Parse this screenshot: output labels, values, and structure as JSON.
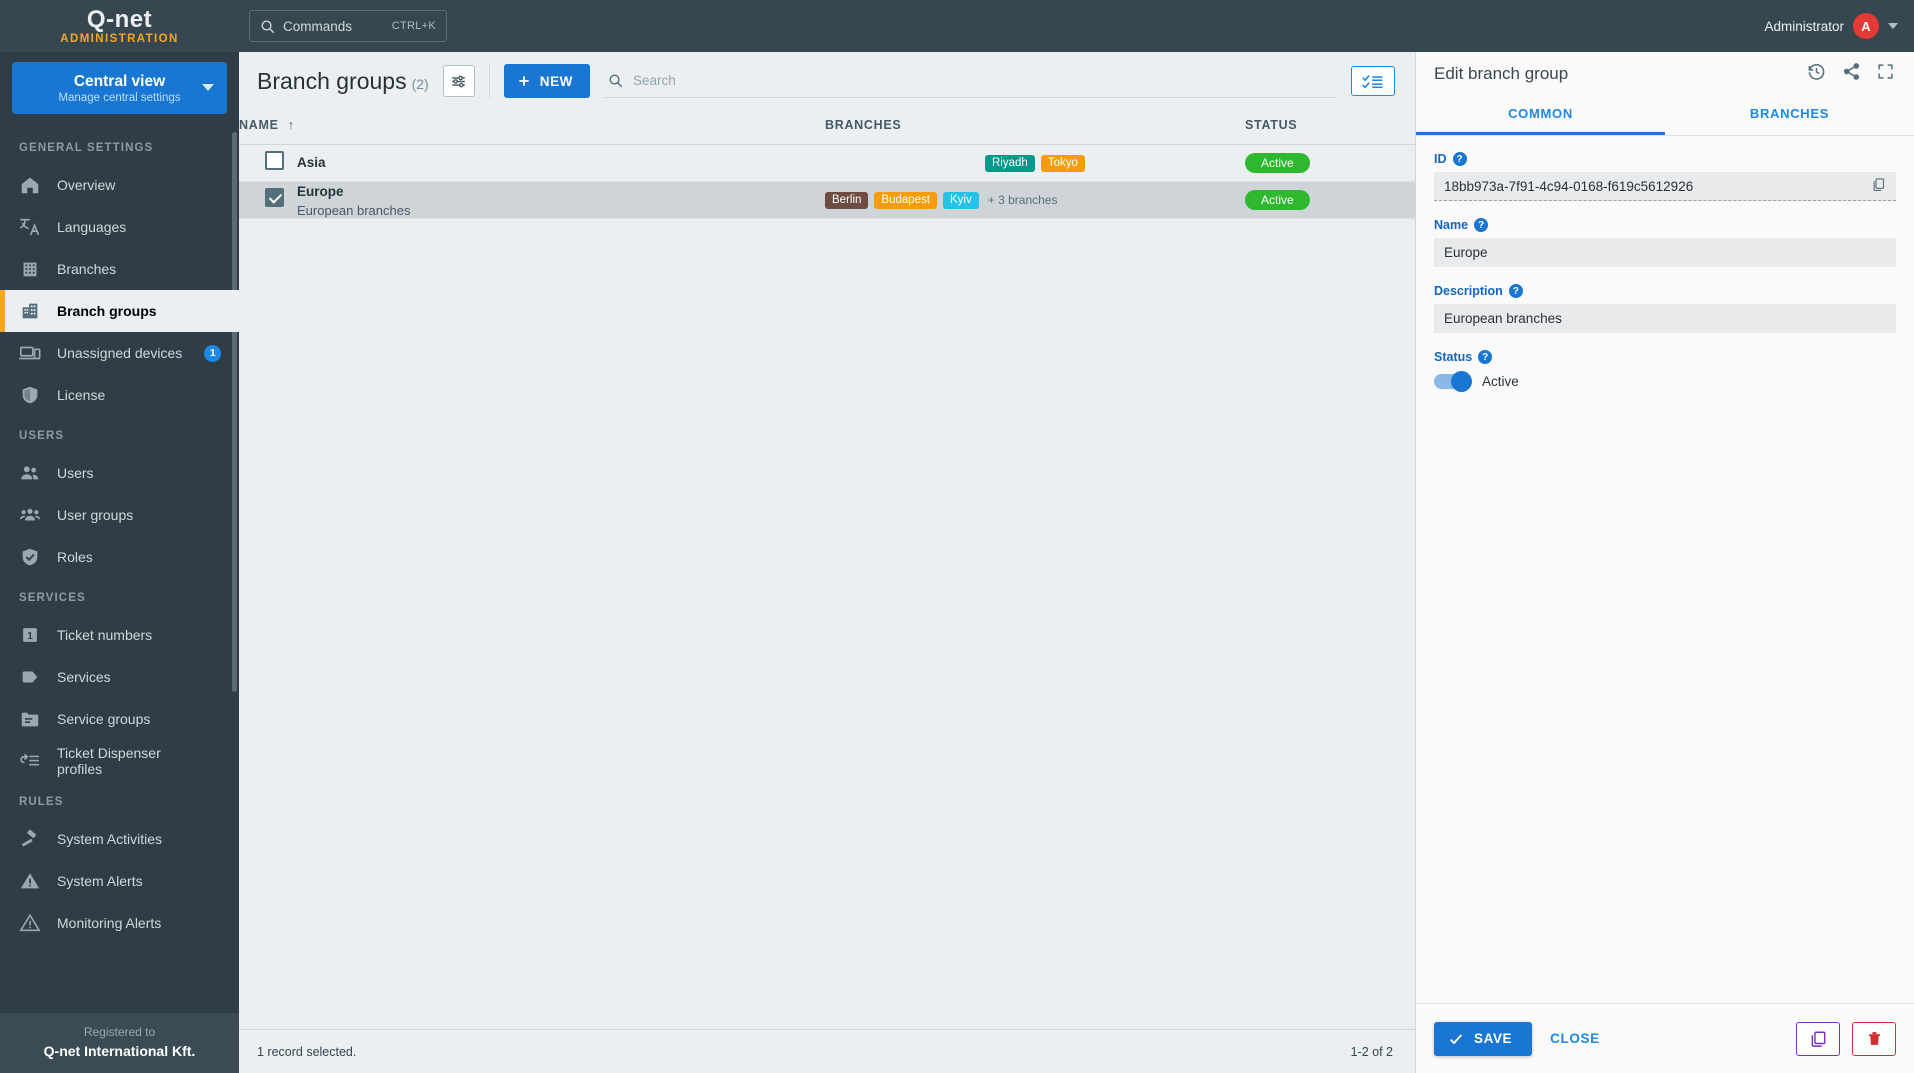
{
  "topbar": {
    "brand_name": "Q-net",
    "brand_sub": "ADMINISTRATION",
    "commands_label": "Commands",
    "commands_shortcut": "CTRL+K",
    "user_name": "Administrator",
    "user_initial": "A"
  },
  "sidebar": {
    "view_title": "Central view",
    "view_subtitle": "Manage central settings",
    "sections": [
      {
        "label": "GENERAL SETTINGS",
        "items": [
          {
            "label": "Overview",
            "icon": "home-icon",
            "active": false
          },
          {
            "label": "Languages",
            "icon": "translate-icon",
            "active": false
          },
          {
            "label": "Branches",
            "icon": "building-icon",
            "active": false
          },
          {
            "label": "Branch groups",
            "icon": "buildings-icon",
            "active": true
          },
          {
            "label": "Unassigned devices",
            "icon": "devices-icon",
            "active": false,
            "badge": "1"
          },
          {
            "label": "License",
            "icon": "shield-icon",
            "active": false
          }
        ]
      },
      {
        "label": "USERS",
        "items": [
          {
            "label": "Users",
            "icon": "users-icon",
            "active": false
          },
          {
            "label": "User groups",
            "icon": "user-group-icon",
            "active": false
          },
          {
            "label": "Roles",
            "icon": "shield-check-icon",
            "active": false
          }
        ]
      },
      {
        "label": "SERVICES",
        "items": [
          {
            "label": "Ticket numbers",
            "icon": "ticket-number-icon",
            "active": false
          },
          {
            "label": "Services",
            "icon": "tag-icon",
            "active": false
          },
          {
            "label": "Service groups",
            "icon": "folder-icon",
            "active": false
          },
          {
            "label": "Ticket Dispenser profiles",
            "icon": "dispenser-icon",
            "active": false
          }
        ]
      },
      {
        "label": "RULES",
        "items": [
          {
            "label": "System Activities",
            "icon": "gavel-icon",
            "active": false
          },
          {
            "label": "System Alerts",
            "icon": "alert-filled-icon",
            "active": false
          },
          {
            "label": "Monitoring Alerts",
            "icon": "alert-outline-icon",
            "active": false
          }
        ]
      }
    ],
    "footer": {
      "registered_label": "Registered to",
      "company": "Q-net International Kft."
    }
  },
  "main": {
    "title": "Branch groups",
    "count": "(2)",
    "new_button": "NEW",
    "search_placeholder": "Search",
    "search_value": "",
    "columns": [
      "NAME",
      "BRANCHES",
      "STATUS"
    ],
    "sort_column": "NAME",
    "sort_direction": "asc",
    "rows": [
      {
        "name": "Asia",
        "description": "",
        "selected": false,
        "branches": [
          {
            "label": "Riyadh",
            "color": "#00998a"
          },
          {
            "label": "Tokyo",
            "color": "#f59c0b"
          }
        ],
        "more_branches": "",
        "status": "Active"
      },
      {
        "name": "Europe",
        "description": "European branches",
        "selected": true,
        "branches": [
          {
            "label": "Berlin",
            "color": "#6d4c41"
          },
          {
            "label": "Budapest",
            "color": "#f59c0b"
          },
          {
            "label": "Kyiv",
            "color": "#22c3e6"
          }
        ],
        "more_branches": "+ 3 branches",
        "status": "Active"
      }
    ],
    "footer_left": "1 record selected.",
    "footer_right": "1-2 of 2"
  },
  "panel": {
    "title": "Edit branch group",
    "tabs": [
      {
        "label": "COMMON",
        "active": true
      },
      {
        "label": "BRANCHES",
        "active": false
      }
    ],
    "fields": {
      "id_label": "ID",
      "id_value": "18bb973a-7f91-4c94-0168-f619c5612926",
      "name_label": "Name",
      "name_value": "Europe",
      "description_label": "Description",
      "description_value": "European branches",
      "status_label": "Status",
      "status_toggle_label": "Active",
      "status_toggle_on": true
    },
    "save_label": "SAVE",
    "close_label": "CLOSE"
  },
  "colors": {
    "accent_blue": "#1976d2",
    "sidebar_bg": "#2f3e46",
    "topbar_bg": "#37474f",
    "active_marker": "#f5a623",
    "status_green": "#2eb82e",
    "avatar_red": "#e53935",
    "duplicate_purple": "#7b2fbe",
    "delete_red": "#d32f2f"
  }
}
